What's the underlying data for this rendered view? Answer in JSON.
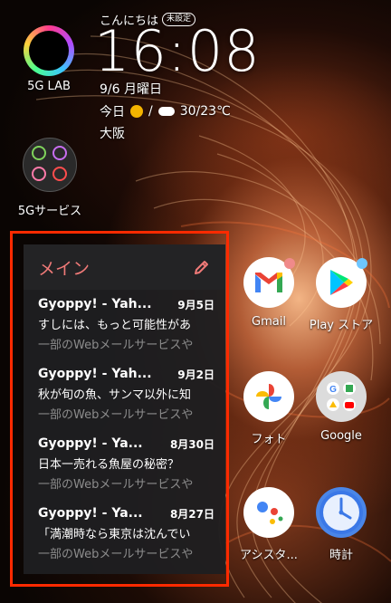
{
  "left_apps": [
    {
      "label": "5G LAB",
      "icon": "5g-lab-icon"
    },
    {
      "label": "5Gサービス",
      "icon": "5g-services-icon"
    }
  ],
  "clock": {
    "greeting": "こんにちは",
    "badge": "未設定",
    "time": "16:08",
    "date": "9/6 月曜日",
    "weather_label": "今日",
    "temps": "30/23℃",
    "city": "大阪"
  },
  "widget": {
    "title": "メイン",
    "mails": [
      {
        "sender": "Gyoppy! - Yah...",
        "date": "9月5日",
        "subject": "すしには、もっと可能性があ",
        "preview": "一部のWebメールサービスや"
      },
      {
        "sender": "Gyoppy! - Yah...",
        "date": "9月2日",
        "subject": "秋が旬の魚、サンマ以外に知",
        "preview": "一部のWebメールサービスや"
      },
      {
        "sender": "Gyoppy! - Ya...",
        "date": "8月30日",
        "subject": "日本一売れる魚屋の秘密？",
        "preview": "一部のWebメールサービスや"
      },
      {
        "sender": "Gyoppy! - Ya...",
        "date": "8月27日",
        "subject": "「満潮時なら東京は沈んでい",
        "preview": "一部のWebメールサービスや"
      }
    ]
  },
  "right_apps": [
    {
      "label": "Gmail",
      "icon": "gmail-icon"
    },
    {
      "label": "Play ストア",
      "icon": "play-store-icon"
    },
    {
      "label": "フォト",
      "icon": "photos-icon"
    },
    {
      "label": "Google",
      "icon": "google-folder-icon"
    },
    {
      "label": "アシスタ...",
      "icon": "assistant-icon"
    },
    {
      "label": "時計",
      "icon": "clock-icon"
    }
  ],
  "colors": {
    "highlight": "#ff2a00",
    "widget_title": "#f07a78"
  }
}
